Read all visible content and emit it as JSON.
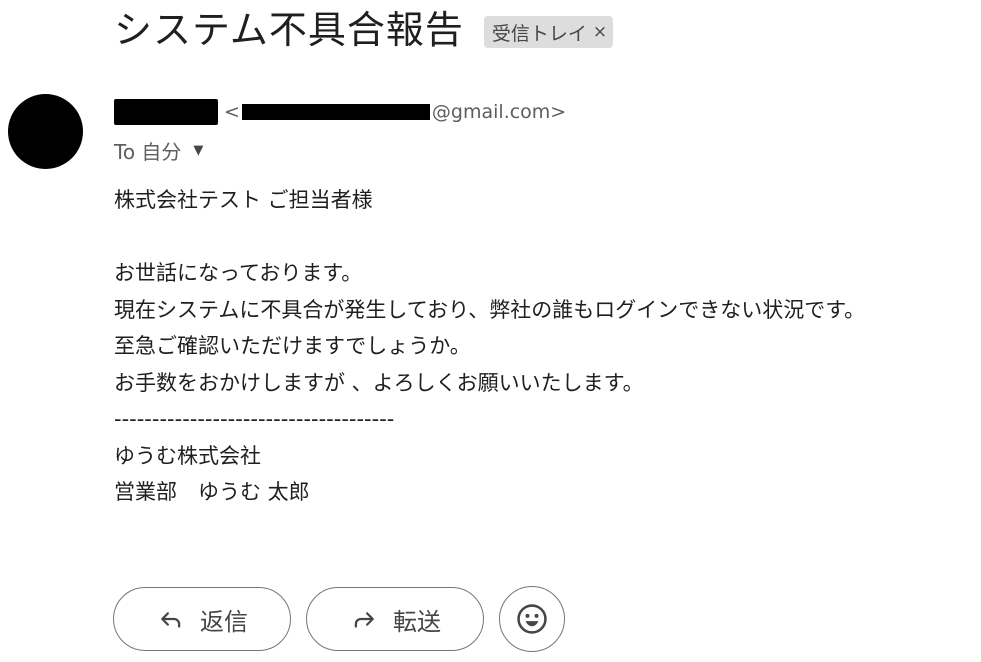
{
  "subject": "システム不具合報告",
  "label": {
    "name": "受信トレイ",
    "close": "×"
  },
  "sender": {
    "email_open": "<",
    "email_domain": "@gmail.com>",
    "recipient": "To 自分",
    "recipient_caret": "▼"
  },
  "body": {
    "lines": [
      "株式会社テスト ご担当者様",
      "",
      "お世話になっております。",
      "現在システムに不具合が発生しており、弊社の誰もログインできない状況です。",
      "至急ご確認いただけますでしょうか。",
      "お手数をおかけしますが 、よろしくお願いいたします。",
      "-------------------------------------",
      "ゆうむ株式会社",
      "営業部　ゆうむ 太郎"
    ]
  },
  "actions": {
    "reply_label": "返信",
    "forward_label": "転送"
  },
  "icons": {
    "reply": "reply-icon",
    "forward": "forward-icon",
    "emoji": "emoji-icon"
  }
}
